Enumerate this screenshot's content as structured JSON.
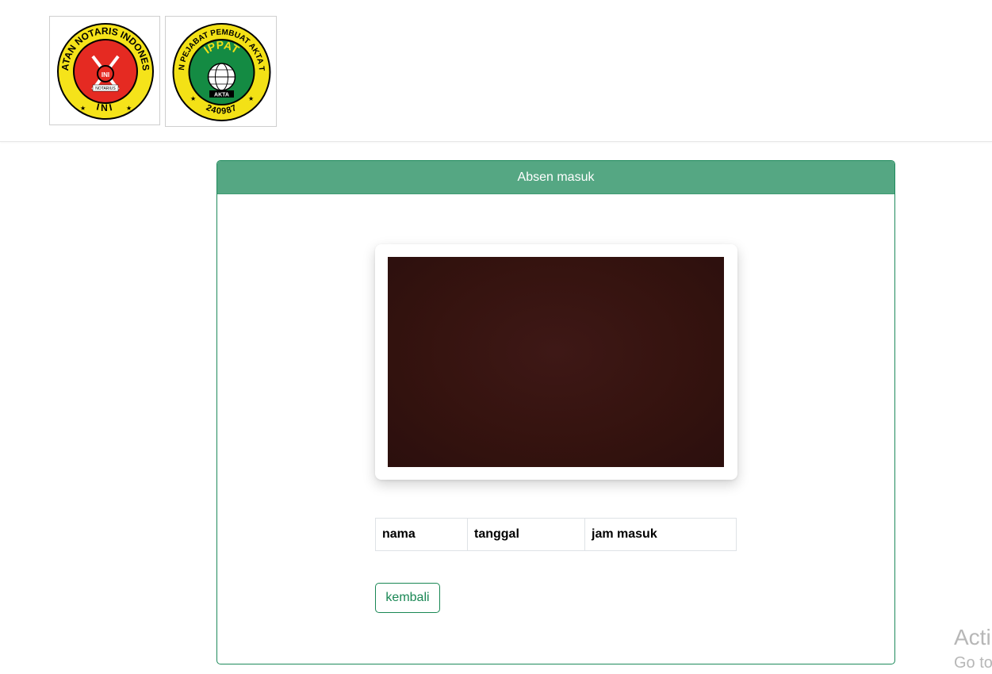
{
  "header": {
    "logos": [
      {
        "name": "ini-logo",
        "text_top": "IKATAN NOTARIS INDONESIA",
        "text_bottom": "INI",
        "emblem": "INI",
        "ribbon": "NOTARIUS"
      },
      {
        "name": "ippat-logo",
        "text_top": "IKATAN PEJABAT PEMBUAT AKTA TANAH",
        "text_bottom": "240987",
        "emblem": "IPPAT",
        "ribbon": "AKTA"
      }
    ]
  },
  "card": {
    "title": "Absen masuk"
  },
  "camera": {
    "icon": "camera-feed"
  },
  "table": {
    "headers": [
      "nama",
      "tanggal",
      "jam masuk"
    ]
  },
  "actions": {
    "back_label": "kembali"
  },
  "watermark": {
    "line1": "Acti",
    "line2": "Go to"
  },
  "colors": {
    "primary_green": "#198754",
    "header_green": "#55a783",
    "camera_bg": "#35130f"
  }
}
